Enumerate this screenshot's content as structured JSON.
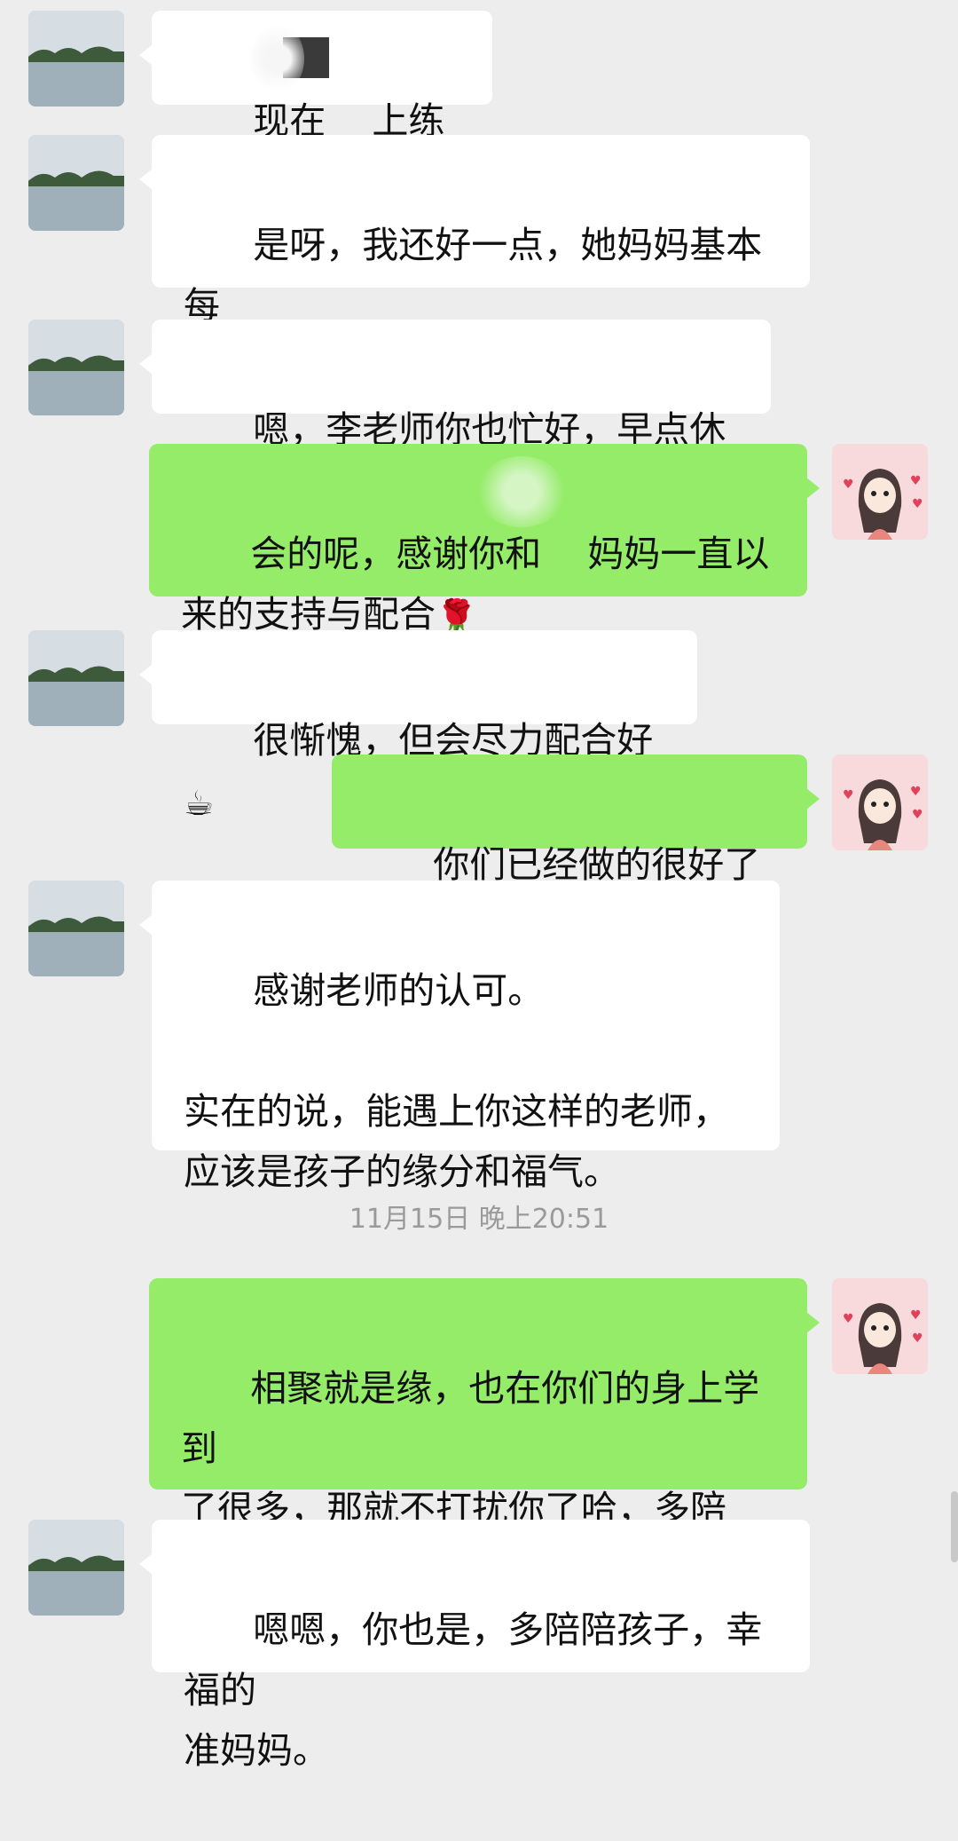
{
  "messages": [
    {
      "side": "left",
      "text": "现在    上练字"
    },
    {
      "side": "left",
      "text": "是呀，我还好一点，她妈妈基本每\n天要课后延时服务"
    },
    {
      "side": "left",
      "text": "嗯，李老师你也忙好，早点休息。"
    },
    {
      "side": "right",
      "text": "会的呢，感谢你和    妈妈一直以\n来的支持与配合",
      "emoji": "🌹"
    },
    {
      "side": "left",
      "text": "很惭愧，但会尽力配合好",
      "emoji": "☕"
    },
    {
      "side": "right",
      "text": "你们已经做的很好了",
      "emoji": "👌"
    },
    {
      "side": "left",
      "text": "感谢老师的认可。\n\n实在的说，能遇上你这样的老师，\n应该是孩子的缘分和福气。"
    },
    {
      "side": "right",
      "text": "相聚就是缘，也在你们的身上学到\n了很多，那就不打扰你了哈，多陪\n陪孩子",
      "emoji": "🤗🤗"
    },
    {
      "side": "left",
      "text": "嗯嗯，你也是，多陪陪孩子，幸福的\n准妈妈。"
    }
  ],
  "timestamp": "11月15日 晚上20:51",
  "colors": {
    "background": "#ededed",
    "bubble_self": "#95ec69",
    "bubble_other": "#ffffff",
    "timestamp": "#9a9a9a"
  },
  "icons": {
    "contact_avatar": "lake-landscape-avatar-icon",
    "self_avatar": "cartoon-girl-avatar-icon"
  }
}
